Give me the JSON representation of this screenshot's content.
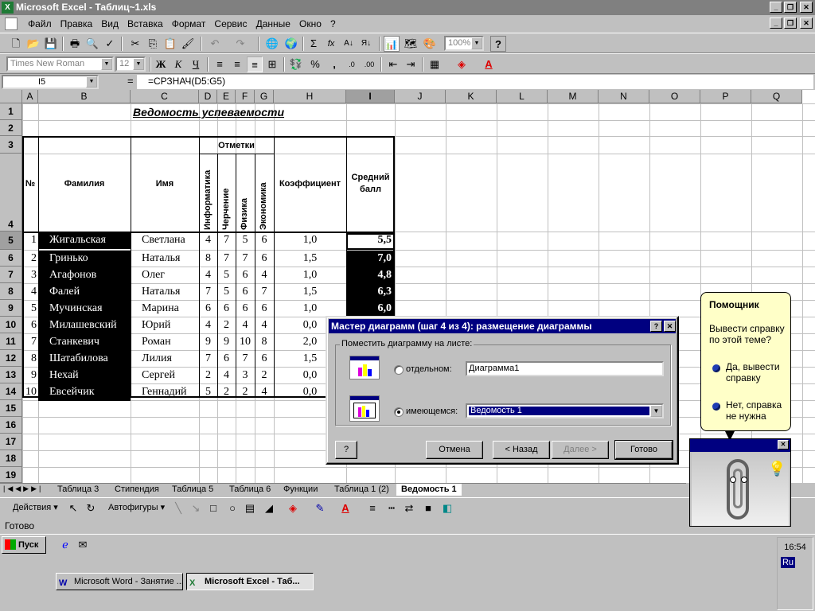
{
  "window": {
    "title": "Microsoft Excel - Таблиц~1.xls",
    "app_icon": "X"
  },
  "menu": [
    "Файл",
    "Правка",
    "Вид",
    "Вставка",
    "Формат",
    "Сервис",
    "Данные",
    "Окно",
    "?"
  ],
  "toolbar": {
    "zoom": "100%",
    "font": "Times New Roman",
    "font_size": "12",
    "bold": "Ж",
    "italic": "К",
    "underline": "Ч",
    "sigma": "Σ",
    "fx": "fx",
    "percent": "%",
    "comma": ","
  },
  "formula_bar": {
    "cell_ref": "I5",
    "equals": "=",
    "formula": "=СРЗНАЧ(D5:G5)"
  },
  "columns": [
    "A",
    "B",
    "C",
    "D",
    "E",
    "F",
    "G",
    "H",
    "I",
    "J",
    "K",
    "L",
    "M",
    "N",
    "O",
    "P",
    "Q"
  ],
  "rows": [
    "1",
    "2",
    "3",
    "4",
    "5",
    "6",
    "7",
    "8",
    "9",
    "10",
    "11",
    "12",
    "13",
    "14",
    "15",
    "16",
    "17",
    "18",
    "19"
  ],
  "sheet_title": "Ведомость успеваемости",
  "headers": {
    "num": "№",
    "surname": "Фамилия",
    "name": "Имя",
    "grades": "Отметки",
    "subjects": [
      "Информатика",
      "Черчение",
      "Физика",
      "Экономика"
    ],
    "coef": "Коэффициент",
    "avg_line1": "Средний",
    "avg_line2": "балл"
  },
  "table_rows": [
    {
      "n": "1",
      "surname": "Жигальская",
      "name": "Светлана",
      "g": [
        "4",
        "7",
        "5",
        "6"
      ],
      "coef": "1,0",
      "avg": "5,5"
    },
    {
      "n": "2",
      "surname": "Гринько",
      "name": "Наталья",
      "g": [
        "8",
        "7",
        "7",
        "6"
      ],
      "coef": "1,5",
      "avg": "7,0"
    },
    {
      "n": "3",
      "surname": "Агафонов",
      "name": "Олег",
      "g": [
        "4",
        "5",
        "6",
        "4"
      ],
      "coef": "1,0",
      "avg": "4,8"
    },
    {
      "n": "4",
      "surname": "Фалей",
      "name": "Наталья",
      "g": [
        "7",
        "5",
        "6",
        "7"
      ],
      "coef": "1,5",
      "avg": "6,3"
    },
    {
      "n": "5",
      "surname": "Мучинская",
      "name": "Марина",
      "g": [
        "6",
        "6",
        "6",
        "6"
      ],
      "coef": "1,0",
      "avg": "6,0"
    },
    {
      "n": "6",
      "surname": "Милашевский",
      "name": "Юрий",
      "g": [
        "4",
        "2",
        "4",
        "4"
      ],
      "coef": "0,0",
      "avg": ""
    },
    {
      "n": "7",
      "surname": "Станкевич",
      "name": "Роман",
      "g": [
        "9",
        "9",
        "10",
        "8"
      ],
      "coef": "2,0",
      "avg": ""
    },
    {
      "n": "8",
      "surname": "Шатабилова",
      "name": "Лилия",
      "g": [
        "7",
        "6",
        "7",
        "6"
      ],
      "coef": "1,5",
      "avg": ""
    },
    {
      "n": "9",
      "surname": "Нехай",
      "name": "Сергей",
      "g": [
        "2",
        "4",
        "3",
        "2"
      ],
      "coef": "0,0",
      "avg": ""
    },
    {
      "n": "10",
      "surname": "Евсейчик",
      "name": "Геннадий",
      "g": [
        "5",
        "2",
        "2",
        "4"
      ],
      "coef": "0,0",
      "avg": ""
    }
  ],
  "dialog": {
    "title": "Мастер диаграмм (шаг 4 из 4): размещение диаграммы",
    "group_label": "Поместить диаграмму на листе:",
    "option_separate": "отдельном:",
    "separate_value": "Диаграмма1",
    "option_existing": "имеющемся:",
    "existing_value": "Ведомость 1",
    "btn_help": "?",
    "btn_cancel": "Отмена",
    "btn_back": "< Назад",
    "btn_next": "Далее >",
    "btn_finish": "Готово"
  },
  "sheet_tabs": [
    "Таблица 3",
    "Стипендия",
    "Таблица 5",
    "Таблица 6",
    "Функции",
    "Таблица 1 (2)",
    "Ведомость 1"
  ],
  "active_tab": "Ведомость 1",
  "drawing": {
    "actions": "Действия ▾",
    "autoshapes": "Автофигуры ▾"
  },
  "status": "Готово",
  "assistant": {
    "title": "Помощник",
    "question": "Вывести справку по этой теме?",
    "yes": "Да, вывести справку",
    "no": "Нет, справка не нужна"
  },
  "taskbar": {
    "start": "Пуск",
    "time": "16:54",
    "lang": "Ru",
    "tasks": [
      "Microsoft Word - Занятие ...",
      "Microsoft Excel - Таб..."
    ]
  }
}
